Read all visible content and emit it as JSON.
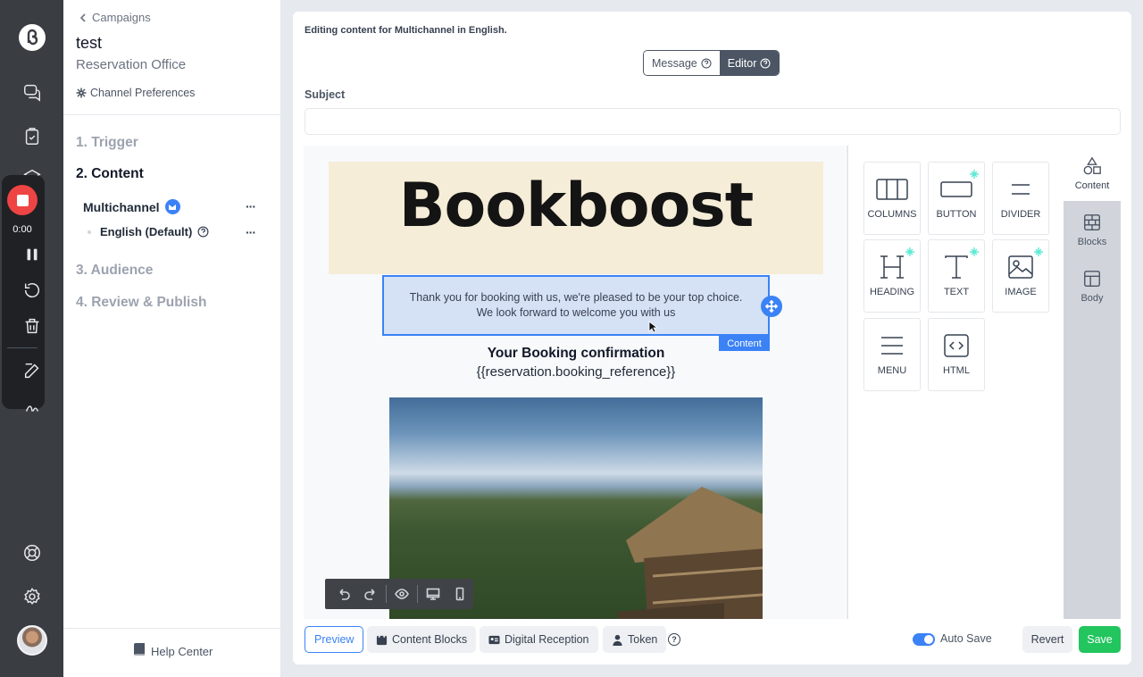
{
  "sidebar": {
    "back_label": "Campaigns",
    "title": "test",
    "subtitle": "Reservation Office",
    "channel_prefs": "Channel Preferences",
    "steps": [
      "1. Trigger",
      "2. Content",
      "3. Audience",
      "4. Review & Publish"
    ],
    "active_step": 1,
    "channel": "Multichannel",
    "language": "English (Default)",
    "more": "···",
    "help": "Help Center"
  },
  "recorder": {
    "time": "0:00"
  },
  "editor": {
    "note": "Editing content for Multichannel in English.",
    "mode_message": "Message",
    "mode_editor": "Editor",
    "subject_label": "Subject",
    "subject_value": ""
  },
  "email": {
    "brand": "Bookboost",
    "intro_line1": "Thank you for booking with us, we're pleased to be your top choice.",
    "intro_line2": "We look forward to welcome you with us",
    "selected_tag": "Content",
    "heading": "Your Booking confirmation",
    "reference": "{{reservation.booking_reference}}"
  },
  "tools": {
    "columns": "COLUMNS",
    "button": "BUTTON",
    "divider": "DIVIDER",
    "heading": "HEADING",
    "text": "TEXT",
    "image": "IMAGE",
    "menu": "MENU",
    "html": "HTML"
  },
  "tabs": {
    "content": "Content",
    "blocks": "Blocks",
    "body": "Body"
  },
  "bottom": {
    "preview": "Preview",
    "content_blocks": "Content Blocks",
    "digital_reception": "Digital Reception",
    "token": "Token",
    "help": "?",
    "autosave": "Auto Save",
    "autosave_on": true,
    "revert": "Revert",
    "save": "Save"
  },
  "colors": {
    "accent": "#3b82f6",
    "save": "#22c55e",
    "header_band": "#f5edd7",
    "rail": "#3a3d42"
  }
}
